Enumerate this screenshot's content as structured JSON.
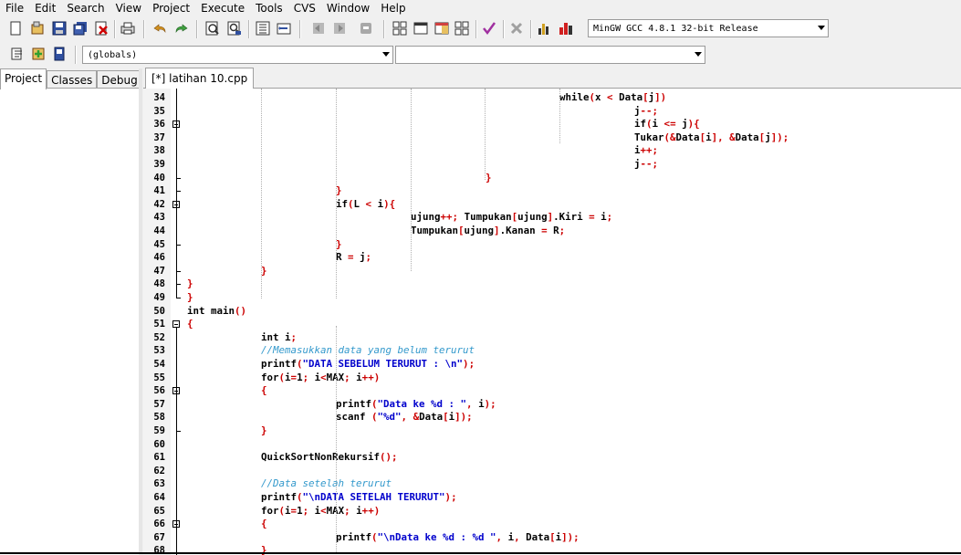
{
  "menu": [
    "File",
    "Edit",
    "Search",
    "View",
    "Project",
    "Execute",
    "Tools",
    "CVS",
    "Window",
    "Help"
  ],
  "toolbar": {
    "compiler": "MinGW GCC 4.8.1 32-bit Release",
    "scope": "(globals)",
    "function": ""
  },
  "icons": [
    "new-file-icon",
    "open-icon",
    "save-icon",
    "save-all-icon",
    "close-icon",
    "print-icon",
    "undo-icon",
    "redo-icon",
    "find-icon",
    "replace-icon",
    "indent-icon",
    "unindent-icon",
    "back-icon",
    "forward-icon",
    "bookmark-icon",
    "grid-icon",
    "window-icon",
    "table-icon",
    "tiles-icon",
    "check-icon",
    "stop-icon",
    "chart-icon",
    "profile-icon"
  ],
  "left_tabs": [
    "Project",
    "Classes",
    "Debug"
  ],
  "editor_tab": "[*] latihan 10.cpp",
  "lines": [
    {
      "n": "34",
      "t": "while(x < Data[j])"
    },
    {
      "n": "35",
      "t": "j--;"
    },
    {
      "n": "36",
      "t": "if(i <= j){"
    },
    {
      "n": "37",
      "t": "Tukar(&Data[i], &Data[j]);"
    },
    {
      "n": "38",
      "t": "i++;"
    },
    {
      "n": "39",
      "t": "j--;"
    },
    {
      "n": "40",
      "t": "}"
    },
    {
      "n": "41",
      "t": "}"
    },
    {
      "n": "42",
      "t": "if(L < i){"
    },
    {
      "n": "43",
      "t": "ujung++; Tumpukan[ujung].Kiri = i;"
    },
    {
      "n": "44",
      "t": "Tumpukan[ujung].Kanan = R;"
    },
    {
      "n": "45",
      "t": "}"
    },
    {
      "n": "46",
      "t": "R = j;"
    },
    {
      "n": "47",
      "t": "}"
    },
    {
      "n": "48",
      "t": "}"
    },
    {
      "n": "49",
      "t": "}"
    },
    {
      "n": "50",
      "t": "int main()"
    },
    {
      "n": "51",
      "t": "{"
    },
    {
      "n": "52",
      "t": "int i;"
    },
    {
      "n": "53",
      "t": "//Memasukkan data yang belum terurut"
    },
    {
      "n": "54",
      "t": "printf(\"DATA SEBELUM TERURUT : \\n\");"
    },
    {
      "n": "55",
      "t": "for(i=1; i<MAX; i++)"
    },
    {
      "n": "56",
      "t": "{"
    },
    {
      "n": "57",
      "t": "printf(\"Data ke %d : \", i);"
    },
    {
      "n": "58",
      "t": "scanf (\"%d\", &Data[i]);"
    },
    {
      "n": "59",
      "t": "}"
    },
    {
      "n": "60",
      "t": ""
    },
    {
      "n": "61",
      "t": "QuickSortNonRekursif();"
    },
    {
      "n": "62",
      "t": ""
    },
    {
      "n": "63",
      "t": "//Data setelah terurut"
    },
    {
      "n": "64",
      "t": "printf(\"\\nDATA SETELAH TERURUT\");"
    },
    {
      "n": "65",
      "t": "for(i=1; i<MAX; i++)"
    },
    {
      "n": "66",
      "t": "{"
    },
    {
      "n": "67",
      "t": "printf(\"\\nData ke %d : %d \", i, Data[i]);"
    },
    {
      "n": "68",
      "t": "}"
    }
  ]
}
